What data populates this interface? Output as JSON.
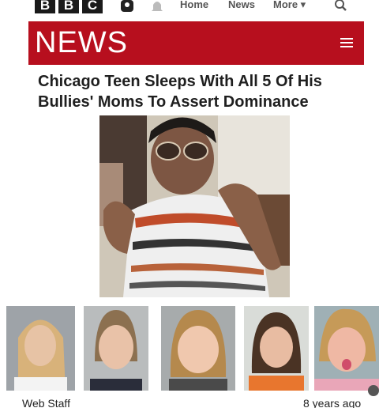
{
  "header": {
    "logo_letters": [
      "B",
      "B",
      "C"
    ],
    "nav_links": {
      "home": "Home",
      "news": "News",
      "more": "More ▾"
    },
    "icons": {
      "account": "account-icon",
      "notifications": "bell-icon",
      "search": "search-icon"
    }
  },
  "banner": {
    "title": "NEWS",
    "color": "#b70f1e",
    "menu_icon": "hamburger-menu-icon"
  },
  "article": {
    "headline_line1": "Chicago Teen Sleeps With All 5 Of His",
    "headline_line2": "Bullies' Moms To Assert Dominance",
    "main_photo": "teen-photo",
    "mugshots": [
      "mugshot-1",
      "mugshot-2",
      "mugshot-3",
      "mugshot-4",
      "mugshot-5"
    ],
    "byline": "Web Staff",
    "timestamp": "8 years ago"
  }
}
